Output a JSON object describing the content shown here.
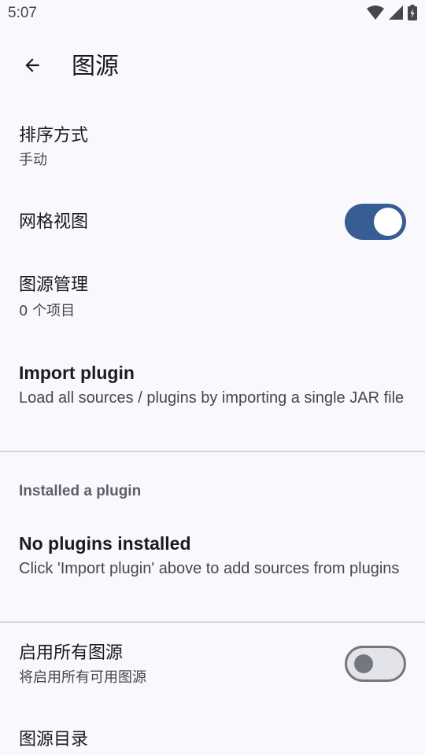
{
  "status_bar": {
    "time": "5:07",
    "icons": [
      "wifi-icon",
      "cellular-signal-icon",
      "battery-charging-icon"
    ]
  },
  "app_bar": {
    "title": "图源",
    "back_icon": "arrow-back-icon"
  },
  "preferences": {
    "sort_order": {
      "title": "排序方式",
      "summary": "手动"
    },
    "grid_view": {
      "title": "网格视图",
      "enabled": true
    },
    "source_management": {
      "title": "图源管理",
      "summary": "0 个项目"
    },
    "import_plugin": {
      "title": "Import plugin",
      "summary": "Load all sources / plugins by importing a single JAR file"
    },
    "installed_section": {
      "header": "Installed a plugin"
    },
    "no_plugins": {
      "title": "No plugins installed",
      "summary": "Click 'Import plugin' above to add sources from plugins"
    },
    "enable_all": {
      "title": "启用所有图源",
      "summary": "将启用所有可用图源",
      "enabled": false
    },
    "source_catalog": {
      "title": "图源目录"
    }
  },
  "colors": {
    "background": "#f9f8fd",
    "accent": "#375d94",
    "divider": "#d6d7de"
  }
}
